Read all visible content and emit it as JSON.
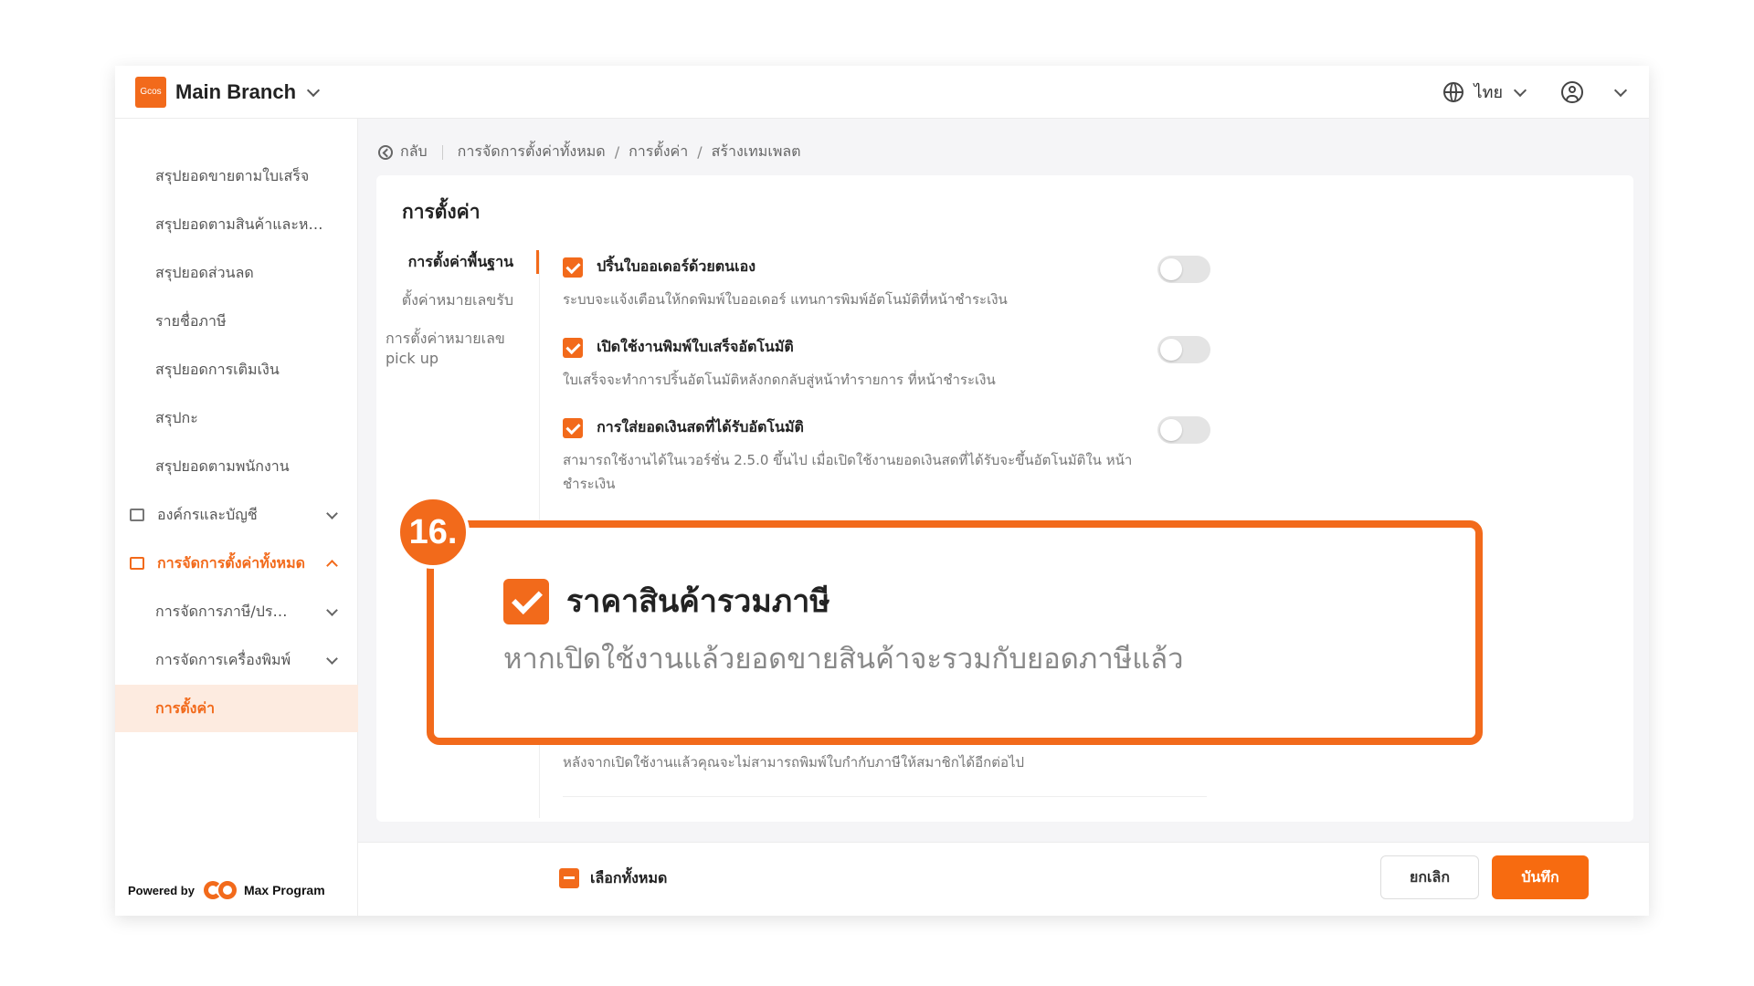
{
  "header": {
    "logo_text": "Gcos",
    "branch_name": "Main Branch",
    "language": "ไทย"
  },
  "sidebar": {
    "items": [
      {
        "label": "สรุปยอดขายตามใบเสร็จ"
      },
      {
        "label": "สรุปยอดตามสินค้าและหมวดหมู่"
      },
      {
        "label": "สรุปยอดส่วนลด"
      },
      {
        "label": "รายชื่อภาษี"
      },
      {
        "label": "สรุปยอดการเติมเงิน"
      },
      {
        "label": "สรุปกะ"
      },
      {
        "label": "สรุปยอดตามพนักงาน"
      }
    ],
    "group_org": "องค์กรและบัญชี",
    "group_settings": "การจัดการตั้งค่าทั้งหมด",
    "sub_tax": "การจัดการภาษี/ประเภท",
    "sub_printer": "การจัดการเครื่องพิมพ์",
    "active_item": "การตั้งค่า",
    "powered_by": "Powered by",
    "powered_brand": "Max Program"
  },
  "breadcrumb": {
    "back": "กลับ",
    "level1": "การจัดการตั้งค่าทั้งหมด",
    "level2": "การตั้งค่า",
    "level3": "สร้างเทมเพลต",
    "separator": "/"
  },
  "card": {
    "title": "การตั้งค่า",
    "tabs": [
      "การตั้งค่าพื้นฐาน",
      "ตั้งค่าหมายเลขรับ",
      "การตั้งค่าหมายเลข pick up"
    ],
    "settings": [
      {
        "title": "ปริ้นใบออเดอร์ด้วยตนเอง",
        "desc": "ระบบจะแจ้งเตือนให้กดพิมพ์ใบออเดอร์ แทนการพิมพ์อัตโนมัติที่หน้าชำระเงิน",
        "enabled": false
      },
      {
        "title": "เปิดใช้งานพิมพ์ใบเสร็จอัตโนมัติ",
        "desc": "ใบเสร็จจะทำการปริ้นอัตโนมัติหลังกดกลับสู่หน้าทำรายการ ที่หน้าชำระเงิน",
        "enabled": false
      },
      {
        "title": "การใส่ยอดเงินสดที่ได้รับอัตโนมัติ",
        "desc": "สามารถใช้งานได้ในเวอร์ชั่น 2.5.0 ขึ้นไป เมื่อเปิดใช้งานยอดเงินสดที่ได้รับจะขึ้นอัตโนมัติใน หน้าชำระเงิน",
        "enabled": false
      }
    ],
    "bottom_desc": "หลังจากเปิดใช้งานแล้วคุณจะไม่สามารถพิมพ์ใบกำกับภาษีให้สมาชิกได้อีกต่อไป"
  },
  "footer": {
    "select_all": "เลือกทั้งหมด",
    "cancel": "ยกเลิก",
    "save": "บันทึก"
  },
  "callout": {
    "step": "16.",
    "title": "ราคาสินค้ารวมภาษี",
    "desc": "หากเปิดใช้งานแล้วยอดขายสินค้าจะรวมกับยอดภาษีแล้ว"
  },
  "colors": {
    "accent": "#f26a1b",
    "active_bg": "#fdebe0"
  }
}
